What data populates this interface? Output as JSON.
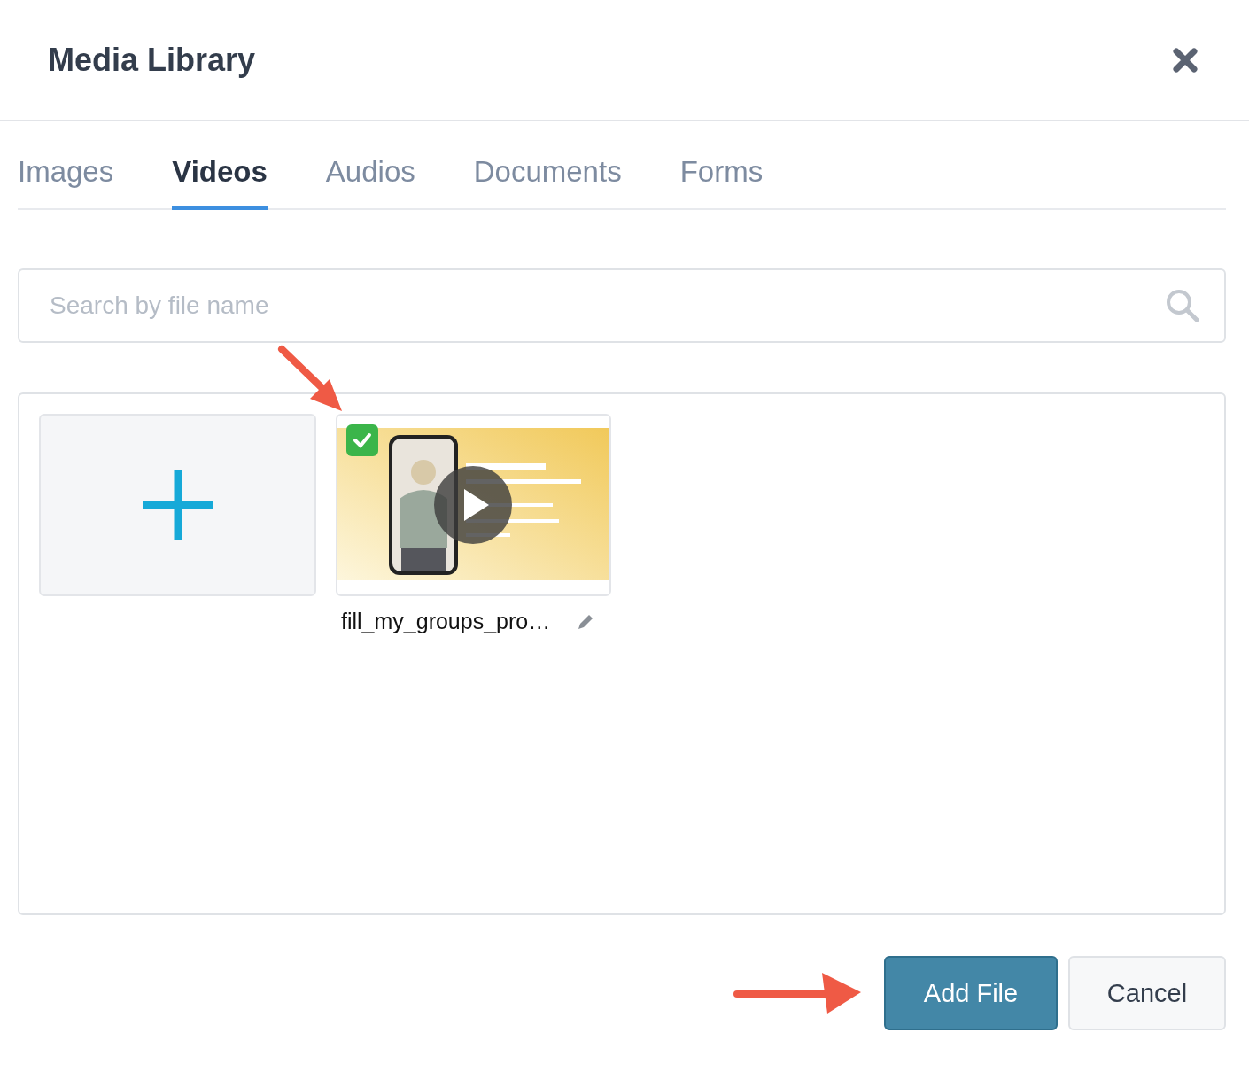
{
  "window": {
    "title": "Media Library"
  },
  "tabs": [
    {
      "label": "Images",
      "selected": false
    },
    {
      "label": "Videos",
      "selected": true
    },
    {
      "label": "Audios",
      "selected": false
    },
    {
      "label": "Documents",
      "selected": false
    },
    {
      "label": "Forms",
      "selected": false
    }
  ],
  "search": {
    "placeholder": "Search by file name"
  },
  "media": [
    {
      "kind": "upload"
    },
    {
      "kind": "video",
      "name": "fill_my_groups_pro…",
      "selected": true
    }
  ],
  "buttons": [
    {
      "label": "Add File",
      "kind": "primary"
    },
    {
      "label": "Cancel",
      "kind": "secondary"
    }
  ]
}
